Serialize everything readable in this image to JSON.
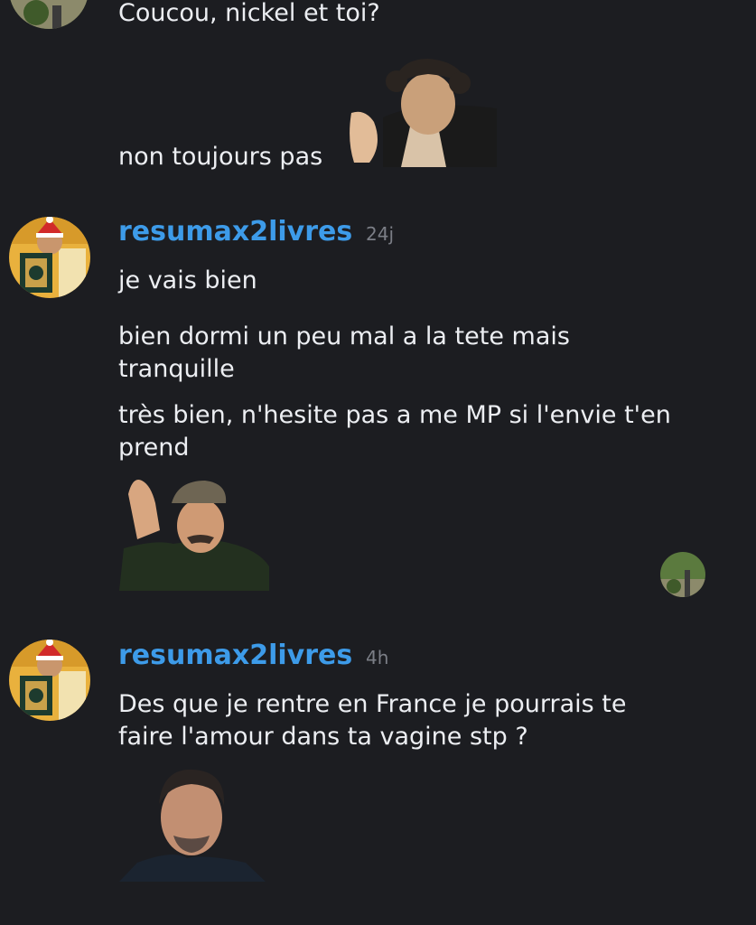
{
  "messages": [
    {
      "text": "Coucou, nickel et toi?"
    },
    {
      "text": "non toujours pas"
    }
  ],
  "groups": [
    {
      "username": "resumax2livres",
      "time": "24j",
      "messages": [
        "je vais bien",
        "bien dormi un peu mal a la tete mais\ntranquille",
        "très bien, n'hesite pas a me MP si l'envie t'en\nprend"
      ]
    },
    {
      "username": "resumax2livres",
      "time": "4h",
      "messages": [
        "Des que je rentre en France je pourrais te\nfaire l'amour dans ta vagine stp ?"
      ]
    }
  ],
  "colors": {
    "background": "#1c1d21",
    "username": "#3d9be9",
    "text": "#eceef2",
    "timestamp": "#7b7e86"
  },
  "icons": {
    "top_avatar": "user-avatar-garden",
    "group_avatar": "user-avatar-santa-book",
    "read_receipt": "read-receipt-avatar",
    "stickers": [
      "sticker-clapping-man",
      "sticker-waving-man-cap",
      "sticker-man-portrait"
    ]
  }
}
